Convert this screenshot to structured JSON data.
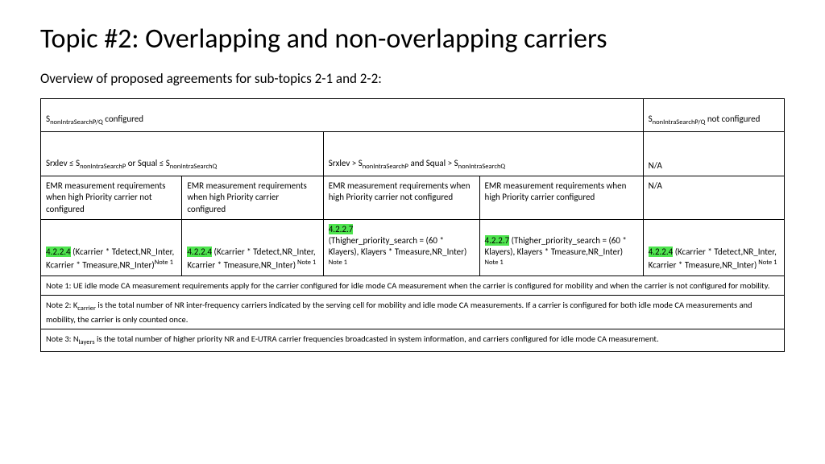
{
  "title": "Topic #2: Overlapping and non-overlapping carriers",
  "subtitle": "Overview of proposed agreements for sub-topics 2-1 and 2-2:",
  "row1": {
    "c1_a": "S",
    "c1_sub": "nonIntraSearchP/Q",
    "c1_b": " configured",
    "c2_a": "S",
    "c2_sub": "nonIntraSearchP/Q",
    "c2_b": " not configured"
  },
  "row2": {
    "c1_a": "Srxlev ≤ S",
    "c1_sub1": "nonIntraSearchP",
    "c1_b": " or Squal ≤ S",
    "c1_sub2": "nonIntraSearchQ",
    "c2_a": "Srxlev > S",
    "c2_sub1": "nonIntraSearchP",
    "c2_b": " and Squal > S",
    "c2_sub2": "nonIntraSearchQ",
    "c3": "N/A"
  },
  "row3": {
    "c1": "EMR measurement requirements when high Priority carrier not configured",
    "c2": "EMR measurement requirements when high Priority carrier configured",
    "c3": "EMR measurement requirements when high Priority carrier not configured",
    "c4": "EMR measurement requirements when high Priority carrier configured",
    "c5": " N/A"
  },
  "row4": {
    "c1_ref": "4.2.2.4",
    "c1_txt": " (Kcarrier * Tdetect,NR_Inter, Kcarrier * Tmeasure,NR_Inter)",
    "c1_note": "Note 1",
    "c2_ref": "4.2.2.4",
    "c2_txt": " (Kcarrier * Tdetect,NR_Inter, Kcarrier * Tmeasure,NR_Inter)",
    "c2_note": " Note 1",
    "c3_ref": "4.2.2.7",
    "c3_txt_a": "(Thigher_priority_search = (60 * Klayers), Klayers * Tmeasure,NR_Inter)",
    "c3_note": " Note 1",
    "c4_ref": "4.2.2.7",
    "c4_txt": " (Thigher_priority_search = (60 * Klayers), Klayers * Tmeasure,NR_Inter)",
    "c4_note": " Note 1",
    "c5_ref": "4.2.2.4",
    "c5_txt": " (Kcarrier * Tdetect,NR_Inter, Kcarrier * Tmeasure,NR_Inter)",
    "c5_note": " Note 1"
  },
  "notes": {
    "n1": "Note 1: UE idle mode CA measurement requirements apply for the carrier configured for idle mode CA measurement when the carrier is configured for mobility and when the carrier is not configured for mobility.",
    "n2_a": "Note 2: K",
    "n2_sub": "carrier",
    "n2_b": " is the total number of NR inter-frequency carriers indicated by the serving cell for mobility and idle mode CA measurements. If a carrier is configured for both idle mode CA measurements and mobility, the carrier is only counted once.",
    "n3_a": "Note 3: N",
    "n3_sub": "layers",
    "n3_b": " is the total number of higher priority NR and E-UTRA carrier frequencies broadcasted in system information, and carriers configured for idle mode CA measurement."
  }
}
